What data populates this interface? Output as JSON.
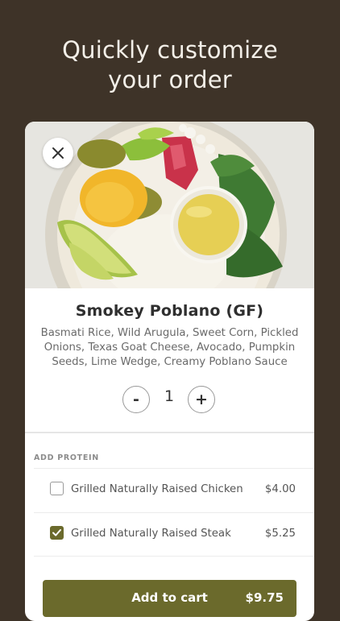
{
  "headline": {
    "line1": "Quickly customize",
    "line2": "your order"
  },
  "item": {
    "name": "Smokey Poblano (GF)",
    "description_line1": "Basmati Rice, Wild Arugula, Sweet Corn, Pickled",
    "description_line2": "Onions, Texas Goat Cheese, Avocado, Pumpkin",
    "description_line3": "Seeds, Lime Wedge, Creamy Poblano Sauce"
  },
  "quantity": {
    "minus_label": "-",
    "value": "1",
    "plus_label": "+"
  },
  "protein": {
    "section_label": "ADD PROTEIN",
    "options": [
      {
        "name": "Grilled Naturally Raised Chicken",
        "price": "$4.00",
        "checked": false
      },
      {
        "name": "Grilled Naturally Raised Steak",
        "price": "$5.25",
        "checked": true
      }
    ]
  },
  "cart": {
    "label": "Add to cart",
    "price": "$9.75"
  },
  "colors": {
    "background": "#3e3328",
    "accent": "#6b6a2c"
  },
  "icons": {
    "close": "close-icon",
    "check": "checkmark-icon"
  }
}
